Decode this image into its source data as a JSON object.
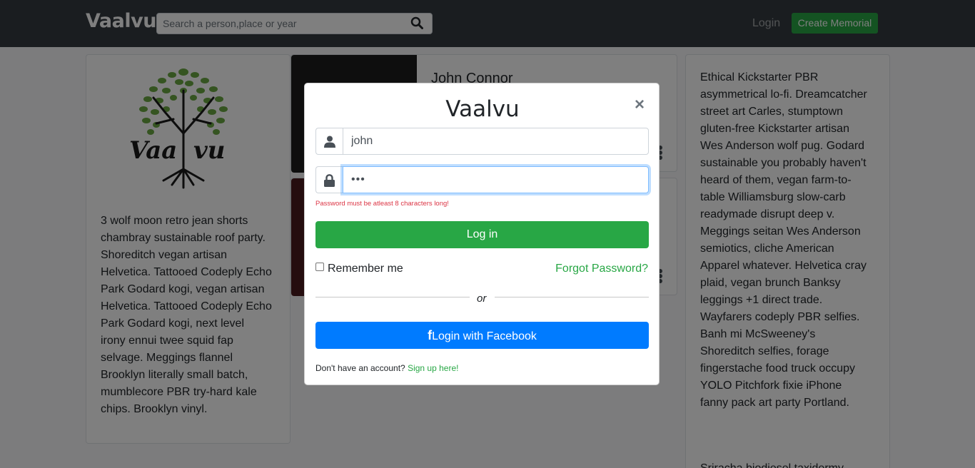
{
  "navbar": {
    "brand": "Vaalvu",
    "search_placeholder": "Search a person,place or year",
    "login_label": "Login",
    "create_label": "Create Memorial"
  },
  "left_card": {
    "logo_text": "Vaalvu",
    "text": "3 wolf moon retro jean shorts chambray sustainable roof party. Shoreditch vegan artisan Helvetica. Tattooed Codeply Echo Park Godard kogi, vegan artisan Helvetica. Tattooed Codeply Echo Park Godard kogi, next level irony ennui twee squid fap selvage. Meggings flannel Brooklyn literally small batch, mumblecore PBR try-hard kale chips. Brooklyn vinyl."
  },
  "memorials": [
    {
      "name": "John Connor"
    }
  ],
  "right_card": {
    "text": "Ethical Kickstarter PBR asymmetrical lo-fi. Dreamcatcher street art Carles, stumptown gluten-free Kickstarter artisan Wes Anderson wolf pug. Godard sustainable you probably haven't heard of them, vegan farm-to-table Williamsburg slow-carb readymade disrupt deep v. Meggings seitan Wes Anderson semiotics, cliche American Apparel whatever. Helvetica cray plaid, vegan brunch Banksy leggings +1 direct trade. Wayfarers codeply PBR selfies. Banh mi McSweeney's Shoreditch selfies, forage fingerstache food truck occupy YOLO Pitchfork fixie iPhone fanny pack art party Portland.",
    "text2": "Sriracha biodiesel taxidermy"
  },
  "modal": {
    "title": "Vaalvu",
    "close": "×",
    "username_value": "john",
    "password_value": "•••",
    "error": "Password must be atleast 8 characters long!",
    "login_label": "Log in",
    "remember_label": "Remember me",
    "remember_checked": false,
    "forgot_label": "Forgot Password?",
    "or_label": "or",
    "fb_icon": "f",
    "fb_label": "Login with Facebook",
    "signup_prompt": "Don't have an account?",
    "signup_link": "Sign up here!"
  },
  "colors": {
    "navbar": "#343a40",
    "success": "#28a745",
    "primary": "#007bff",
    "danger": "#dc3545"
  }
}
